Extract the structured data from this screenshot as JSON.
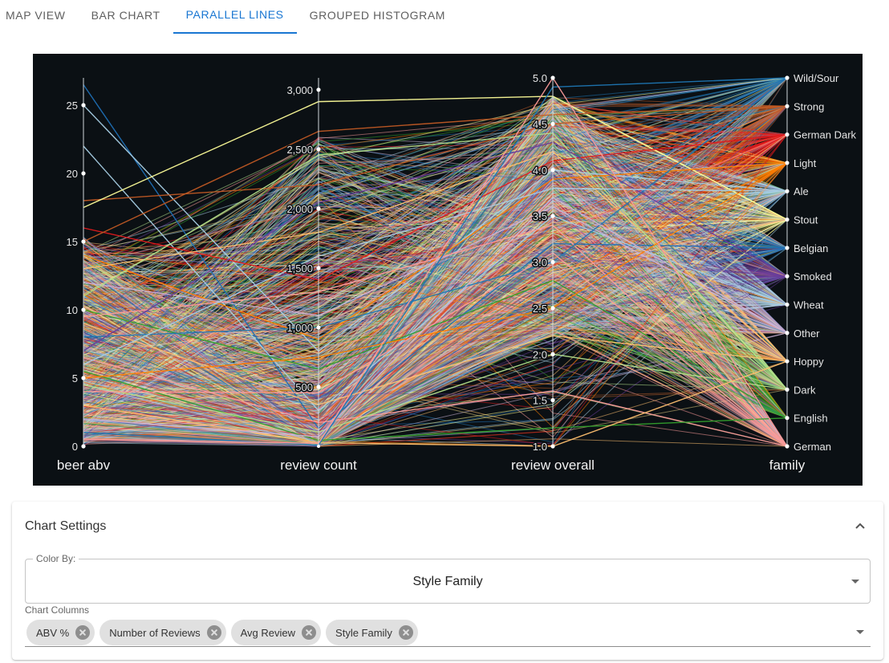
{
  "tabs": [
    {
      "label": "MAP VIEW",
      "active": false
    },
    {
      "label": "BAR CHART",
      "active": false
    },
    {
      "label": "PARALLEL LINES",
      "active": true
    },
    {
      "label": "GROUPED HISTOGRAM",
      "active": false
    }
  ],
  "chart_data": {
    "type": "parallel-coordinates",
    "background": "#0b1014",
    "axes": [
      {
        "name": "beer abv",
        "range": [
          0,
          27
        ],
        "ticks": [
          0,
          5,
          10,
          15,
          20,
          25
        ],
        "tick_labels": [
          "0",
          "5",
          "10",
          "15",
          "20",
          "25"
        ]
      },
      {
        "name": "review count",
        "range": [
          0,
          3100
        ],
        "ticks": [
          500,
          1000,
          1500,
          2000,
          2500,
          3000
        ],
        "tick_labels": [
          "500",
          "1,000",
          "1,500",
          "2,000",
          "2,500",
          "3,000"
        ]
      },
      {
        "name": "review overall",
        "range": [
          1,
          5
        ],
        "ticks": [
          1,
          1.5,
          2,
          2.5,
          3,
          3.5,
          4,
          4.5,
          5
        ],
        "tick_labels": [
          "1.0",
          "1.5",
          "2.0",
          "2.5",
          "3.0",
          "3.5",
          "4.0",
          "4.5",
          "5.0"
        ]
      },
      {
        "name": "family",
        "categorical": true,
        "categories": [
          "Wild/Sour",
          "Strong",
          "German Dark",
          "Light",
          "Ale",
          "Stout",
          "Belgian",
          "Smoked",
          "Wheat",
          "Other",
          "Hoppy",
          "Dark",
          "English",
          "German"
        ]
      }
    ],
    "family_colors": {
      "Wild/Sour": "#1f77b4",
      "Strong": "#c15a24",
      "German Dark": "#e31a1c",
      "Light": "#ff7f00",
      "Ale": "#a6cee3",
      "Stout": "#ffff99",
      "Belgian": "#1f6fb4",
      "Smoked": "#6a3d9a",
      "Wheat": "#a6cee3",
      "Other": "#cab2d6",
      "Hoppy": "#fdbf6f",
      "Dark": "#b2df8a",
      "English": "#33a02c",
      "German": "#fb9a99"
    },
    "sample_lines": [
      {
        "abv": 26.5,
        "count": 150,
        "overall": 3.2,
        "family": "Belgian"
      },
      {
        "abv": 25,
        "count": 800,
        "overall": 4.0,
        "family": "Ale"
      },
      {
        "abv": 22,
        "count": 300,
        "overall": 3.5,
        "family": "Wheat"
      },
      {
        "abv": 18,
        "count": 2200,
        "overall": 4.5,
        "family": "Strong"
      },
      {
        "abv": 17.5,
        "count": 2900,
        "overall": 4.8,
        "family": "Stout"
      },
      {
        "abv": 16,
        "count": 1400,
        "overall": 4.1,
        "family": "German Dark"
      },
      {
        "abv": 15,
        "count": 2650,
        "overall": 4.6,
        "family": "Strong"
      },
      {
        "abv": 14,
        "count": 900,
        "overall": 3.9,
        "family": "Light"
      },
      {
        "abv": 13,
        "count": 1800,
        "overall": 4.2,
        "family": "Hoppy"
      },
      {
        "abv": 12,
        "count": 1100,
        "overall": 3.6,
        "family": "Other"
      },
      {
        "abv": 11,
        "count": 2450,
        "overall": 4.4,
        "family": "Dark"
      },
      {
        "abv": 10,
        "count": 650,
        "overall": 2.8,
        "family": "English"
      },
      {
        "abv": 9.5,
        "count": 1300,
        "overall": 3.4,
        "family": "German"
      },
      {
        "abv": 9,
        "count": 350,
        "overall": 2.2,
        "family": "Hoppy"
      },
      {
        "abv": 8,
        "count": 1000,
        "overall": 3.0,
        "family": "Wild/Sour"
      },
      {
        "abv": 7,
        "count": 2050,
        "overall": 4.3,
        "family": "Smoked"
      },
      {
        "abv": 6.5,
        "count": 200,
        "overall": 1.6,
        "family": "German"
      },
      {
        "abv": 6,
        "count": 1600,
        "overall": 3.8,
        "family": "Ale"
      },
      {
        "abv": 5.5,
        "count": 50,
        "overall": 1.2,
        "family": "English"
      },
      {
        "abv": 5,
        "count": 750,
        "overall": 2.5,
        "family": "Light"
      },
      {
        "abv": 4.5,
        "count": 120,
        "overall": 2.0,
        "family": "Dark"
      },
      {
        "abv": 4,
        "count": 450,
        "overall": 3.1,
        "family": "German"
      },
      {
        "abv": 3,
        "count": 30,
        "overall": 1.0,
        "family": "Hoppy"
      },
      {
        "abv": 2,
        "count": 80,
        "overall": 3.7,
        "family": "Other"
      },
      {
        "abv": 1,
        "count": 10,
        "overall": 4.9,
        "family": "Wild/Sour"
      },
      {
        "abv": 0.5,
        "count": 25,
        "overall": 5.0,
        "family": "German"
      }
    ]
  },
  "settings": {
    "title": "Chart Settings",
    "color_by_label": "Color By:",
    "color_by_value": "Style Family",
    "columns_label": "Chart Columns",
    "columns": [
      "ABV %",
      "Number of Reviews",
      "Avg Review",
      "Style Family"
    ]
  }
}
